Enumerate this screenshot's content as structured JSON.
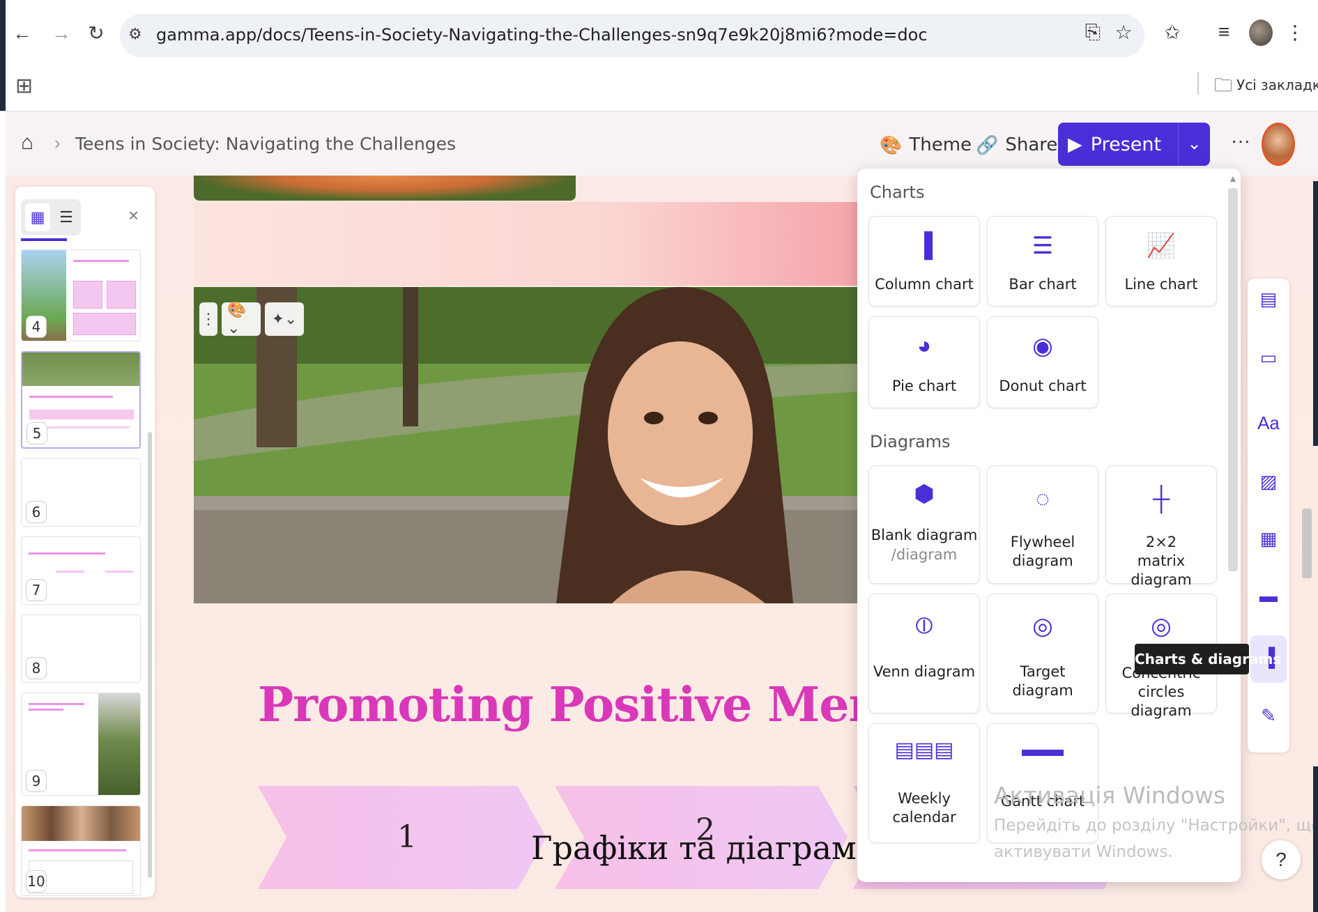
{
  "browser": {
    "url": "gamma.app/docs/Teens-in-Society-Navigating-the-Challenges-sn9q7e9k20j8mi6?mode=doc",
    "bookmarks_label": "Усі закладки"
  },
  "header": {
    "doc_title": "Teens in Society: Navigating the Challenges",
    "theme_label": "Theme",
    "share_label": "Share",
    "present_label": "Present"
  },
  "thumbnails": [
    {
      "num": "4",
      "heading": "Challenges Facing Today's Teenagers"
    },
    {
      "num": "5",
      "heading": "Promoting Positive Mental Health for Teens"
    },
    {
      "num": "6"
    },
    {
      "num": "7",
      "heading": "The Impact of Social Media on Teens"
    },
    {
      "num": "8"
    },
    {
      "num": "9",
      "heading": "Engaging Teens in Community and Civic Life"
    },
    {
      "num": "10",
      "heading": "Empowering the Next Generation of Leaders"
    }
  ],
  "slide": {
    "title": "Promoting Positive Mental Health",
    "steps": [
      "1",
      "2"
    ],
    "caption": "Графіки та діаграми"
  },
  "insert_panel": {
    "charts_heading": "Charts",
    "charts": [
      {
        "label": "Column chart",
        "icon": "column-chart-icon"
      },
      {
        "label": "Bar chart",
        "icon": "bar-chart-icon"
      },
      {
        "label": "Line chart",
        "icon": "line-chart-icon"
      },
      {
        "label": "Pie chart",
        "icon": "pie-chart-icon"
      },
      {
        "label": "Donut chart",
        "icon": "donut-chart-icon"
      }
    ],
    "diagrams_heading": "Diagrams",
    "diagrams": [
      {
        "label": "Blank diagram",
        "sub": "/diagram",
        "icon": "blank-diagram-icon"
      },
      {
        "label": "Flywheel diagram",
        "icon": "flywheel-icon"
      },
      {
        "label": "2×2 matrix diagram",
        "icon": "matrix-icon"
      },
      {
        "label": "Venn diagram",
        "icon": "venn-icon"
      },
      {
        "label": "Target diagram",
        "icon": "target-icon"
      },
      {
        "label": "Concentric circles diagram",
        "icon": "concentric-icon"
      },
      {
        "label": "Weekly calendar",
        "icon": "calendar-icon"
      },
      {
        "label": "Gantt chart",
        "icon": "gantt-icon"
      }
    ]
  },
  "tooltip": "Charts & diagrams",
  "watermark": {
    "title": "Активація Windows",
    "line1": "Перейдіть до розділу \"Настройки\", щоб",
    "line2": "активувати Windows."
  },
  "help_label": "?",
  "colors": {
    "accent": "#4a2fd8",
    "title_pink": "#d938b9"
  }
}
